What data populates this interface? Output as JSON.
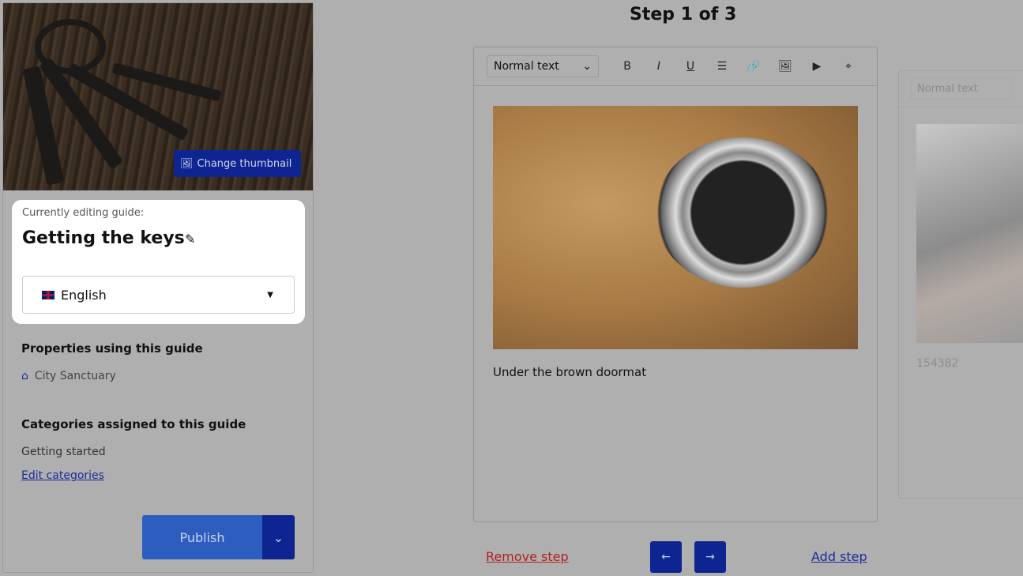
{
  "sidebar": {
    "change_thumbnail": "Change thumbnail",
    "editing_label": "Currently editing guide:",
    "guide_title": "Getting the keys",
    "language": "English",
    "properties_heading": "Properties using this guide",
    "property": "City Sanctuary",
    "categories_heading": "Categories assigned to this guide",
    "category": "Getting started",
    "edit_categories": "Edit categories",
    "publish": "Publish"
  },
  "main": {
    "step_title": "Step 1 of 3",
    "format": "Normal text",
    "toolbar_icons": [
      "bold-icon",
      "italic-icon",
      "underline-icon",
      "list-icon",
      "link-icon",
      "image-icon",
      "video-icon",
      "location-icon"
    ],
    "caption": "Under the brown doormat",
    "remove_step": "Remove step",
    "add_step": "Add step"
  },
  "next_step": {
    "format": "Normal text",
    "caption": "154382"
  },
  "colors": {
    "primary": "#0e2591",
    "publish": "#2d5dbf",
    "danger": "#b52020",
    "overlay": "#afafaf"
  }
}
